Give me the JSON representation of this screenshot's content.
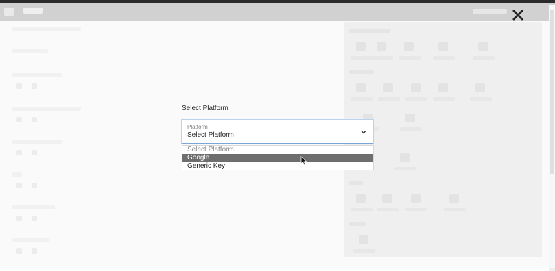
{
  "modal": {
    "label": "Select Platform",
    "select": {
      "floating_label": "Platform",
      "value": "Select Platform"
    },
    "options": [
      {
        "label": "Select Platform",
        "state": "placeholder"
      },
      {
        "label": "Google",
        "state": "highlighted"
      },
      {
        "label": "Generic Key",
        "state": "normal"
      }
    ]
  },
  "icons": {
    "close": "close-icon",
    "dropdown": "chevron-down-icon",
    "cursor": "mouse-cursor-icon"
  },
  "colors": {
    "select_border": "#7aa7d8",
    "highlight": "#6e6e6e",
    "close": "#222222"
  }
}
